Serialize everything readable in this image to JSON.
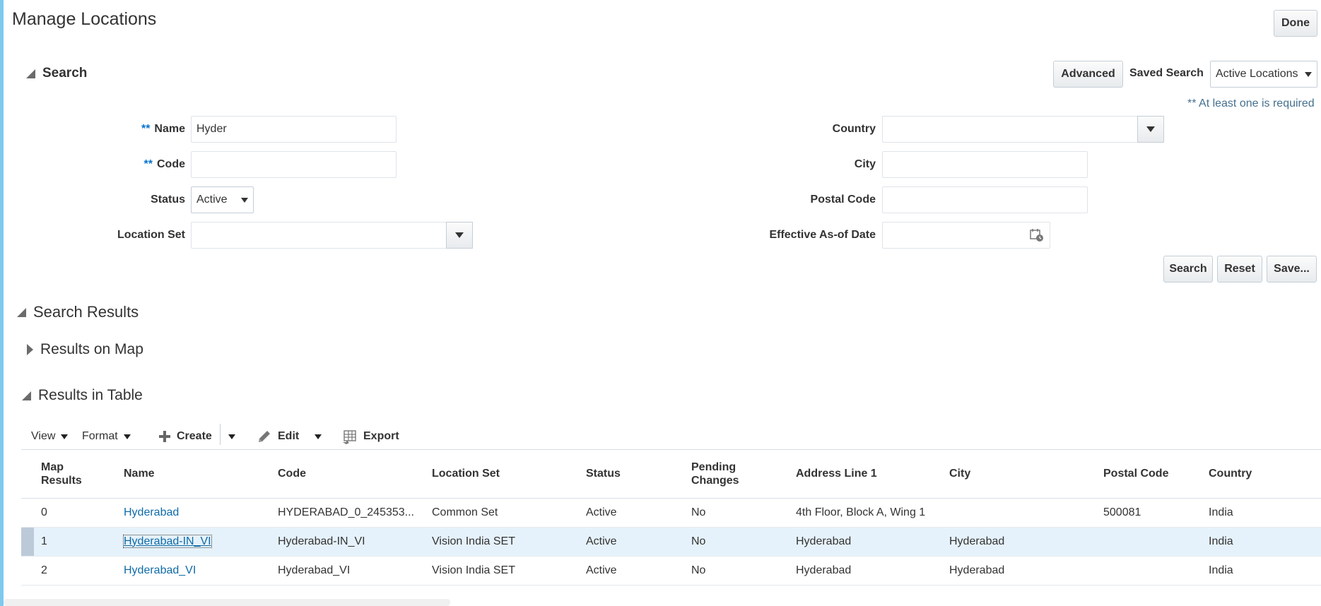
{
  "page": {
    "title": "Manage Locations",
    "done_label": "Done"
  },
  "search": {
    "heading": "Search",
    "advanced_label": "Advanced",
    "saved_search_label": "Saved Search",
    "saved_search_value": "Active Locations",
    "required_hint": "** At least one is required",
    "required_marker": "**",
    "fields": {
      "name": {
        "label": "Name",
        "value": "Hyder"
      },
      "code": {
        "label": "Code",
        "value": ""
      },
      "status": {
        "label": "Status",
        "value": "Active"
      },
      "location_set": {
        "label": "Location Set",
        "value": ""
      },
      "country": {
        "label": "Country",
        "value": ""
      },
      "city": {
        "label": "City",
        "value": ""
      },
      "postal_code": {
        "label": "Postal Code",
        "value": ""
      },
      "effective_date": {
        "label": "Effective As-of Date",
        "value": ""
      }
    },
    "buttons": {
      "search": "Search",
      "reset": "Reset",
      "save": "Save..."
    }
  },
  "results": {
    "heading": "Search Results",
    "map_heading": "Results on Map",
    "table_heading": "Results in Table",
    "toolbar": {
      "view": "View",
      "format": "Format",
      "create": "Create",
      "edit": "Edit",
      "export": "Export"
    },
    "columns": {
      "map_results_1": "Map",
      "map_results_2": "Results",
      "name": "Name",
      "code": "Code",
      "location_set": "Location Set",
      "status": "Status",
      "pending_1": "Pending",
      "pending_2": "Changes",
      "address_line_1": "Address Line 1",
      "city": "City",
      "postal_code": "Postal Code",
      "country": "Country"
    },
    "rows": [
      {
        "map": "0",
        "name": "Hyderabad",
        "code": "HYDERABAD_0_245353...",
        "location_set": "Common Set",
        "status": "Active",
        "pending": "No",
        "address": "4th Floor, Block A, Wing 1",
        "city": "",
        "postal": "500081",
        "country": "India"
      },
      {
        "map": "1",
        "name": "Hyderabad-IN_VI",
        "code": "Hyderabad-IN_VI",
        "location_set": "Vision India SET",
        "status": "Active",
        "pending": "No",
        "address": "Hyderabad",
        "city": "Hyderabad",
        "postal": "",
        "country": "India"
      },
      {
        "map": "2",
        "name": "Hyderabad_VI",
        "code": "Hyderabad_VI",
        "location_set": "Vision India SET",
        "status": "Active",
        "pending": "No",
        "address": "Hyderabad",
        "city": "Hyderabad",
        "postal": "",
        "country": "India"
      }
    ]
  },
  "colors": {
    "accent_bar": "#7fc8ee",
    "link": "#0f6ba8",
    "selected_row": "#e6f2fb",
    "required_marker": "#0572ce"
  },
  "icons": [
    "caret-down-icon",
    "collapse-triangle-icon",
    "expand-triangle-icon",
    "plus-icon",
    "pencil-icon",
    "export-icon",
    "calendar-icon"
  ]
}
